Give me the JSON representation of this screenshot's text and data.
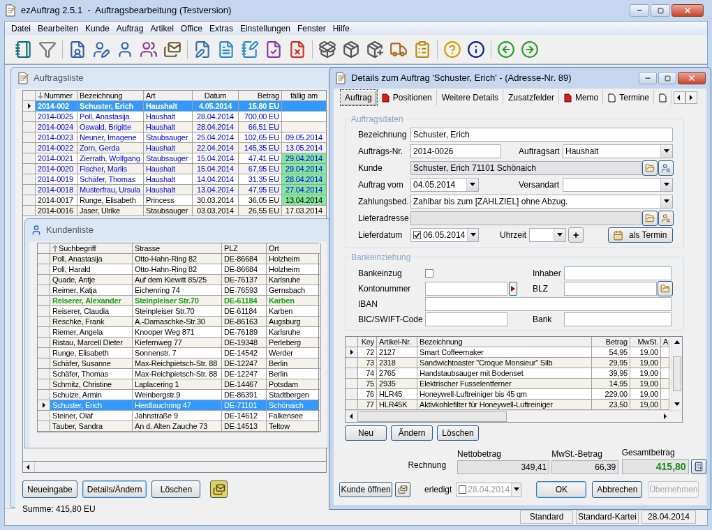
{
  "window": {
    "title": "ezAuftrag 2.5.1  -  Auftragsbearbeitung (Testversion)"
  },
  "menu": [
    "Datei",
    "Bearbeiten",
    "Kunde",
    "Auftrag",
    "Artikel",
    "Office",
    "Extras",
    "Einstellungen",
    "Fenster",
    "Hilfe"
  ],
  "orders_window": {
    "title": "Auftragsliste",
    "columns": [
      {
        "label": "Nummer",
        "kind": "sorted-down"
      },
      {
        "label": "Bezeichnung",
        "kind": "plain"
      },
      {
        "label": "Art",
        "kind": "plain"
      },
      {
        "label": "Datum",
        "kind": "plain"
      },
      {
        "label": "Betrag",
        "kind": "plain"
      },
      {
        "label": "fällig am",
        "kind": "plain"
      }
    ],
    "rows": [
      {
        "cells": [
          "2014-002",
          "Schuster, Erich",
          "Haushalt",
          "4.05.2014",
          "15,80 EU"
        ],
        "overdue": false,
        "selected": true
      },
      {
        "cells": [
          "2014-0025",
          "Poll, Anastasija",
          "Haushalt",
          "28.04.2014",
          "700,00 EU"
        ],
        "kind": "open",
        "overdue": false,
        "selected": false
      },
      {
        "cells": [
          "2014-0024",
          "Oswald, Brigitte",
          "Haushalt",
          "28.04.2014",
          "66,51 EU"
        ],
        "kind": "open",
        "overdue": false,
        "selected": false
      },
      {
        "cells": [
          "2014-0023",
          "Neuner, Imagene",
          "Staubsauger",
          "25.04.2014",
          "102,65 EU",
          "09.05.2014"
        ],
        "kind": "open",
        "overdue": false,
        "selected": false
      },
      {
        "cells": [
          "2014-0022",
          "Zorn, Gerda",
          "Haushalt",
          "22.04.2014",
          "145,35 EU",
          "13.05.2014"
        ],
        "kind": "open",
        "overdue": false,
        "selected": false
      },
      {
        "cells": [
          "2014-0021",
          "Zierrath, Wolfgang",
          "Staubsauger",
          "15.04.2014",
          "47,41 EU",
          "29.04.2014"
        ],
        "kind": "open",
        "overdue": true,
        "selected": false
      },
      {
        "cells": [
          "2014-0020",
          "Fischer, Marlis",
          "Haushalt",
          "15.04.2014",
          "67,95 EU",
          "29.04.2014"
        ],
        "kind": "open",
        "overdue": true,
        "selected": false
      },
      {
        "cells": [
          "2014-0019",
          "Schäfer, Thomas",
          "Haushalt",
          "14.04.2014",
          "31,35 EU",
          "28.04.2014"
        ],
        "kind": "open",
        "overdue": true,
        "selected": false
      },
      {
        "cells": [
          "2014-0018",
          "Musterfrau, Ursula",
          "Haushalt",
          "13.04.2014",
          "47,95 EU",
          "27.04.2014"
        ],
        "kind": "open",
        "overdue": true,
        "selected": false
      },
      {
        "cells": [
          "2014-0017",
          "Runge, Elisabeth",
          "Princess",
          "30.03.2014",
          "36,05 EU",
          "13.04.2014"
        ],
        "kind": "done",
        "overdue": true,
        "selected": false
      },
      {
        "cells": [
          "2014-0016",
          "Jaser, Ulrike",
          "Staubsauger",
          "03.03.2014",
          "26,55 EU",
          "17.03.2014"
        ],
        "kind": "done",
        "overdue": false,
        "selected": false
      }
    ],
    "buttons": [
      {
        "label": "Neueingabe",
        "default": false
      },
      {
        "label": "Details/Ändern",
        "default": true
      },
      {
        "label": "Löschen",
        "default": false
      }
    ],
    "sum": "Summe: 415,80 EU"
  },
  "customers_window": {
    "title": "Kundenliste",
    "columns": [
      {
        "label": "Suchbegriff",
        "kind": "sorted-up"
      },
      {
        "label": "Strasse",
        "kind": "plain"
      },
      {
        "label": "PLZ",
        "kind": "plain"
      },
      {
        "label": "Ort",
        "kind": "plain"
      }
    ],
    "rows": [
      {
        "cells": [
          "Poll, Anastasija",
          "Otto-Hahn-Ring 82",
          "DE-86684",
          "Holzheim"
        ],
        "highlighted": false,
        "selected": false
      },
      {
        "cells": [
          "Poll, Harald",
          "Otto-Hahn-Ring 82",
          "DE-86684",
          "Holzheim"
        ],
        "highlighted": false,
        "selected": false
      },
      {
        "cells": [
          "Quade, Antje",
          "Auf dem Kiewitt 85/25",
          "DE-76137",
          "Karlsruhe"
        ],
        "highlighted": false,
        "selected": false
      },
      {
        "cells": [
          "Reimer, Katja",
          "Eichenring 74",
          "DE-76593",
          "Gernsbach"
        ],
        "highlighted": false,
        "selected": false
      },
      {
        "cells": [
          "Reiserer, Alexander",
          "Steinpleiser Str.70",
          "DE-61184",
          "Karben"
        ],
        "highlighted": true,
        "selected": false
      },
      {
        "cells": [
          "Reiserer, Claudia",
          "Steinpleiser Str.70",
          "DE-61184",
          "Karben"
        ],
        "highlighted": false,
        "selected": false
      },
      {
        "cells": [
          "Reschke, Frank",
          "A.-Damaschke-Str.30",
          "DE-86163",
          "Augsburg"
        ],
        "highlighted": false,
        "selected": false
      },
      {
        "cells": [
          "Riemer, Angela",
          "Knooper Weg 871",
          "DE-76189",
          "Karlsruhe"
        ],
        "highlighted": false,
        "selected": false
      },
      {
        "cells": [
          "Ristau, Marcell Dieter",
          "Kiefernweg 77",
          "DE-19348",
          "Perleberg"
        ],
        "highlighted": false,
        "selected": false
      },
      {
        "cells": [
          "Runge, Elisabeth",
          "Sonnenstr. 7",
          "DE-14542",
          "Werder"
        ],
        "highlighted": false,
        "selected": false
      },
      {
        "cells": [
          "Schäfer, Susanne",
          "Max-Reichpietsch-Str. 88",
          "DE-12247",
          "Berlin"
        ],
        "highlighted": false,
        "selected": false
      },
      {
        "cells": [
          "Schäfer, Thomas",
          "Max-Reichpietsch-Str. 88",
          "DE-12247",
          "Berlin"
        ],
        "highlighted": false,
        "selected": false
      },
      {
        "cells": [
          "Schmitz, Christine",
          "Laplacering 1",
          "DE-14467",
          "Potsdam"
        ],
        "highlighted": false,
        "selected": false
      },
      {
        "cells": [
          "Schulze, Armin",
          "Weinbergstr.9",
          "DE-86391",
          "Stadtbergen"
        ],
        "highlighted": false,
        "selected": false
      },
      {
        "cells": [
          "Schuster, Erich",
          "Herdlauchring 47",
          "DE-71101",
          "Schönaich"
        ],
        "selected": true
      },
      {
        "cells": [
          "Steiner, Olaf",
          "Jahnstraße 9",
          "DE-14612",
          "Falkensee"
        ],
        "highlighted": false,
        "selected": false
      },
      {
        "cells": [
          "Tauber, Sandra",
          "An d. Alten Zauche 73",
          "DE-14513",
          "Teltow"
        ],
        "highlighted": false,
        "selected": false
      }
    ]
  },
  "details_window": {
    "title": "Details zum Auftrag 'Schuster, Erich' - (Adresse-Nr. 89)",
    "tabs": [
      {
        "label": "Auftrag",
        "kind": "plain",
        "selected": true
      },
      {
        "label": "Positionen",
        "kind": "filled",
        "selected": false
      },
      {
        "label": "Weitere Details",
        "kind": "plain",
        "selected": false
      },
      {
        "label": "Zusatzfelder",
        "kind": "plain",
        "selected": false
      },
      {
        "label": "Memo",
        "kind": "filled",
        "selected": false
      },
      {
        "label": "Termine",
        "kind": "page",
        "selected": false
      },
      {
        "kind": "page",
        "selected": false
      }
    ],
    "order_group": {
      "legend": "Auftragsdaten",
      "bezeichnung": {
        "label": "Bezeichnung",
        "value": "Schuster, Erich"
      },
      "nummer": {
        "label": "Auftrags-Nr.",
        "value": "2014-0026"
      },
      "auftragsart": {
        "label": "Auftragsart",
        "value": "Haushalt"
      },
      "kunde": {
        "label": "Kunde",
        "value": "Schuster, Erich 71101 Schönaich"
      },
      "auftrag_vom": {
        "label": "Auftrag vom",
        "value": "04.05.2014"
      },
      "versandart": {
        "label": "Versandart"
      },
      "zahlungsbed": {
        "label": "Zahlungsbed.",
        "value": "Zahlbar bis zum [ZAHLZIEL] ohne Abzug."
      },
      "lieferadresse": {
        "label": "Lieferadresse"
      },
      "lieferdatum": {
        "label": "Lieferdatum",
        "value": "06.05.2014",
        "checked": true
      },
      "uhrzeit": {
        "label": "Uhrzeit"
      },
      "add_button": "+",
      "termin_button": "als Termin"
    },
    "bank_group": {
      "legend": "Bankeinziehung",
      "bankeinzug": {
        "label": "Bankeinzug",
        "checked": false
      },
      "inhaber": "Inhaber",
      "kontonummer": "Kontonummer",
      "blz": "BLZ",
      "iban": "IBAN",
      "bic": "BIC/SWIFT-Code",
      "bank": "Bank"
    },
    "positions": {
      "columns": [
        "Key",
        "Artikel-Nr.",
        "Bezeichnung",
        "Betrag",
        "MwSt.",
        "A"
      ],
      "rows": [
        {
          "cells": [
            "72",
            "2127",
            "Smart Coffeemaker",
            "54,95",
            "19,00"
          ],
          "selected": true
        },
        {
          "cells": [
            "73",
            "2318",
            "Sandwichtoaster \"Croque Monsieur\" Silb",
            "29,95",
            "19,00"
          ],
          "selected": false
        },
        {
          "cells": [
            "74",
            "2765",
            "Handstaubsauger mit Bodenset",
            "39,95",
            "19,00"
          ],
          "selected": false
        },
        {
          "cells": [
            "75",
            "2935",
            "Elektrischer Fusselentferner",
            "14,95",
            "19,00"
          ],
          "selected": false
        },
        {
          "cells": [
            "76",
            "HLR45",
            "Honeywell-Luftreiniger bis 45 qm",
            "229,00",
            "19,00"
          ],
          "selected": false
        },
        {
          "cells": [
            "77",
            "HLR45K",
            "Aktivkohlefilter für Honeywell-Luftreiniger",
            "23,50",
            "19,00"
          ],
          "selected": false
        }
      ]
    },
    "position_buttons": [
      "Neu",
      "Ändern",
      "Löschen"
    ],
    "totals": {
      "row_label": "Rechnung",
      "netto_label": "Nettobetrag",
      "netto": "349,41",
      "mwst_label": "MwSt.-Betrag",
      "mwst": "66,39",
      "gesamt_label": "Gesamtbetrag",
      "gesamt": "415,80"
    },
    "footer": {
      "open_customer": "Kunde öffnen",
      "done_label": "erledigt",
      "done": {
        "checked": false,
        "date": "28.04.2014"
      },
      "ok": "OK",
      "cancel": "Abbrechen",
      "apply": {
        "label": "Übernehmen",
        "disabled": true
      }
    }
  },
  "status_bar": [
    "Standard",
    "Standard-Kartei",
    "28.04.2014"
  ]
}
